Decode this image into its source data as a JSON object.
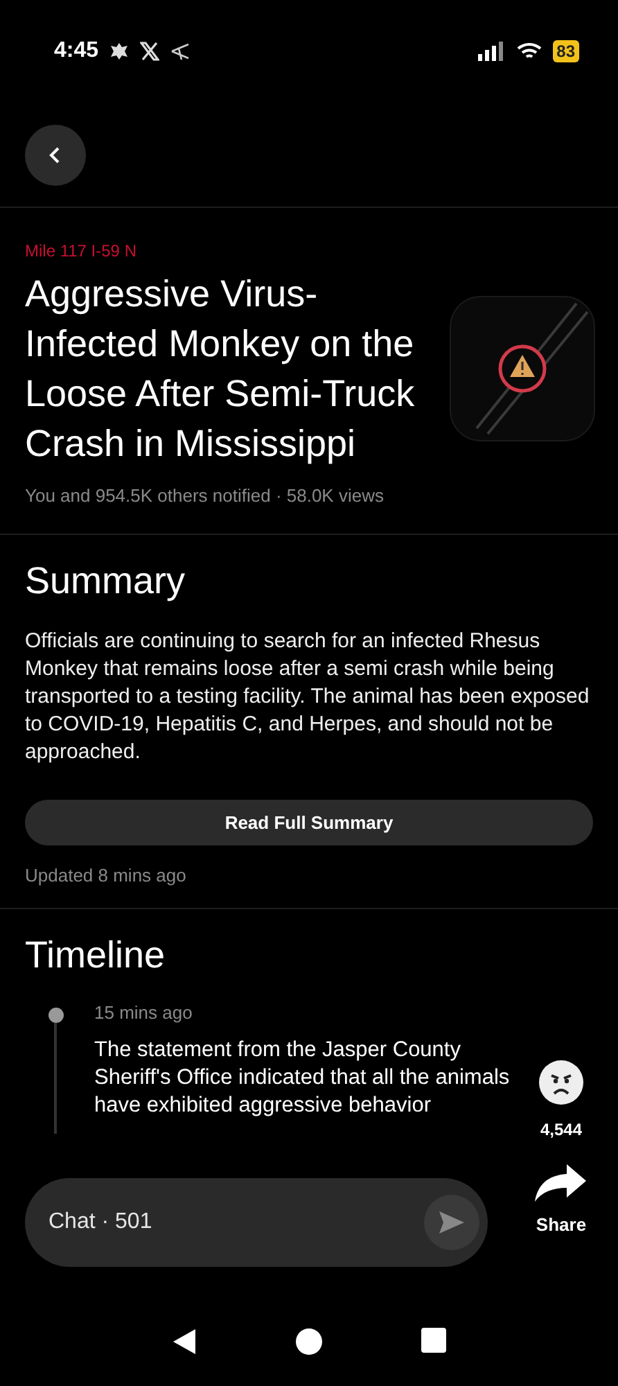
{
  "status_bar": {
    "time": "4:45",
    "battery": "83"
  },
  "location": "Mile 117 I-59 N",
  "headline": "Aggressive Virus-Infected Monkey on the Loose After Semi-Truck Crash in Mississippi",
  "meta": "You and 954.5K others notified · 58.0K views",
  "summary": {
    "heading": "Summary",
    "text": "Officials are continuing to search for an infected Rhesus Monkey that remains loose after a semi crash while being transported to a testing facility.  The animal has been exposed to COVID-19, Hepatitis C, and Herpes, and should not be approached.",
    "button": "Read Full Summary",
    "updated": "Updated 8 mins ago"
  },
  "timeline": {
    "heading": "Timeline",
    "entries": [
      {
        "time": "15 mins ago",
        "text": "The statement from the Jasper County Sheriff's Office indicated that all the animals have exhibited aggressive behavior"
      }
    ]
  },
  "reaction": {
    "count": "4,544"
  },
  "share": {
    "label": "Share"
  },
  "chat": {
    "placeholder": "Chat · 501"
  }
}
